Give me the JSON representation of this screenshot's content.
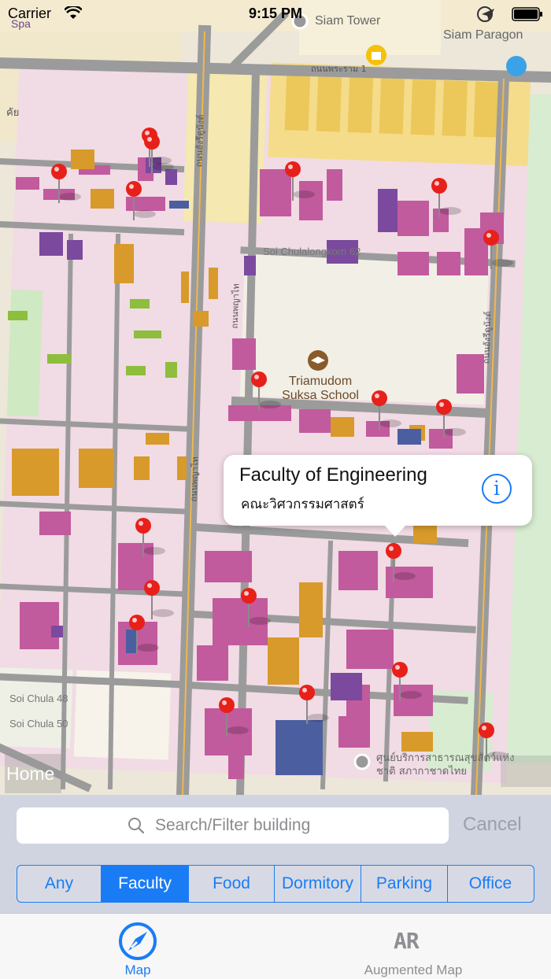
{
  "status_bar": {
    "carrier": "Carrier",
    "time": "9:15 PM",
    "icons": [
      "wifi-icon",
      "location-icon",
      "battery-icon"
    ]
  },
  "map": {
    "labels": {
      "spa": "Spa",
      "siam_tower": "Siam Tower",
      "siam_paragon": "Siam Paragon",
      "rama1_road": "ถนนพระราม 1",
      "henri_dunant_top": "ถนนอังรีดูนังต์",
      "soi_chula_62": "Soi Chulalongkorn 62",
      "phayathai_road": "ถนนพญาไท",
      "school_name": "Triamudom Suksa School",
      "phayathai_road_lower": "ถนนพญาไท",
      "henri_dunant_right": "ถนนอังรีดูนังต์",
      "soi_chula_48": "Soi Chula 48",
      "soi_chula_50": "Soi Chula 50",
      "left_edge": "คัย",
      "animal_center": "ศูนย์บริการสาธารณสุขสัตว์แห่งชาติ สภากาชาดไทย"
    },
    "pin_color": "#e8201a",
    "faculty_color": "#c25a9e",
    "food_color": "#d89a2a"
  },
  "callout": {
    "title": "Faculty of Engineering",
    "subtitle": "คณะวิศวกรรมศาสตร์",
    "info_icon": "info-icon"
  },
  "home_button": {
    "label": "Home"
  },
  "search": {
    "placeholder": "Search/Filter building",
    "cancel_label": "Cancel"
  },
  "filter": {
    "segments": [
      "Any",
      "Faculty",
      "Food",
      "Dormitory",
      "Parking",
      "Office"
    ],
    "selected": "Faculty"
  },
  "tab_bar": {
    "tabs": [
      {
        "label": "Map",
        "icon": "compass-icon",
        "active": true
      },
      {
        "label": "Augmented Map",
        "icon": "ar-icon",
        "active": false
      }
    ],
    "ar_icon_text": "AR"
  },
  "accent_color": "#1a7cf5"
}
